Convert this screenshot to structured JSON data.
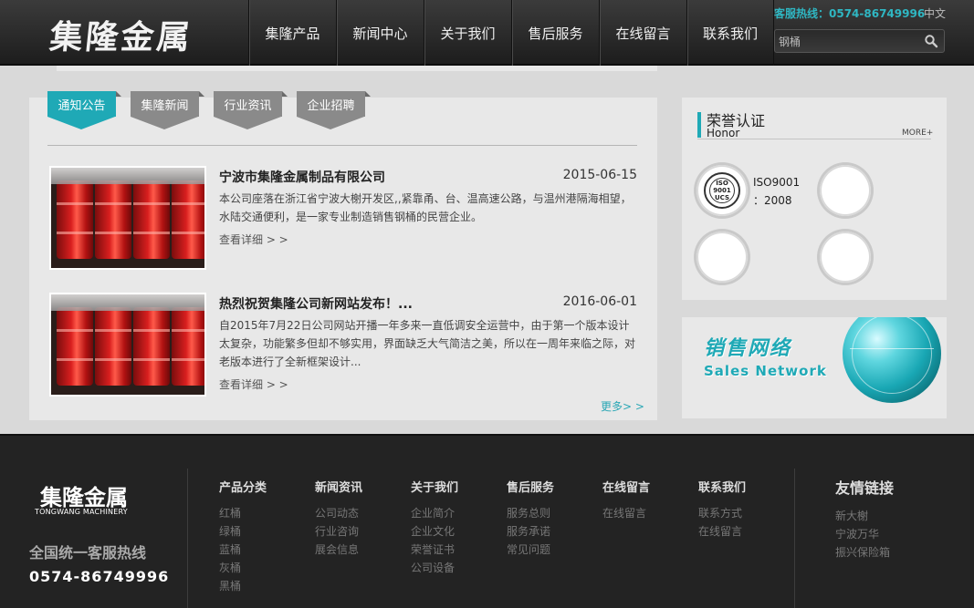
{
  "header": {
    "logo": "集隆金属",
    "nav": [
      "集隆产品",
      "新闻中心",
      "关于我们",
      "售后服务",
      "在线留言",
      "联系我们"
    ],
    "hotline": "客服热线：0574-86749996",
    "lang": "中文",
    "search_value": "钢桶"
  },
  "news": {
    "tabs": [
      "通知公告",
      "集隆新闻",
      "行业资讯",
      "企业招聘"
    ],
    "active_tab": 0,
    "items": [
      {
        "title": "宁波市集隆金属制品有限公司",
        "date": "2015-06-15",
        "desc": "本公司座落在浙江省宁波大榭开发区,,紧靠甬、台、温高速公路，与温州港隔海相望，水陆交通便利，是一家专业制造销售钢桶的民营企业。",
        "more": "查看详细 > >"
      },
      {
        "title": "热烈祝贺集隆公司新网站发布！...",
        "date": "2016-06-01",
        "desc": "自2015年7月22日公司网站开播一年多来一直低调安全运营中，由于第一个版本设计太复杂，功能繁多但却不够实用，界面缺乏大气简洁之美，所以在一周年来临之际，对老版本进行了全新框架设计...",
        "more": "查看详细 > >"
      }
    ],
    "more": "更多> >"
  },
  "honor": {
    "title": "荣誉认证",
    "subtitle": "Honor",
    "more": "MORE+",
    "cert_label_1": "ISO9001",
    "cert_label_2": "：2008",
    "iso_text_1": "ISO",
    "iso_text_2": "9001",
    "iso_text_3": "UCS"
  },
  "sales": {
    "cn": "销售网络",
    "en": "Sales Network"
  },
  "footer": {
    "logo": "集隆金属",
    "logo_en": "TONGWANG MACHINERY",
    "hotline_label": "全国统一客服热线",
    "hotline": "0574-86749996",
    "columns": [
      {
        "title": "产品分类",
        "items": [
          "红桶",
          "绿桶",
          "蓝桶",
          "灰桶",
          "黑桶"
        ]
      },
      {
        "title": "新闻资讯",
        "items": [
          "公司动态",
          "行业咨询",
          "展会信息"
        ]
      },
      {
        "title": "关于我们",
        "items": [
          "企业简介",
          "企业文化",
          "荣誉证书",
          "公司设备"
        ]
      },
      {
        "title": "售后服务",
        "items": [
          "服务总则",
          "服务承诺",
          "常见问题"
        ]
      },
      {
        "title": "在线留言",
        "items": [
          "在线留言"
        ]
      },
      {
        "title": "联系我们",
        "items": [
          "联系方式",
          "在线留言"
        ]
      }
    ],
    "links": {
      "title": "友情链接",
      "items": [
        "新大榭",
        "宁波万华",
        "振兴保险箱"
      ]
    }
  },
  "colors": {
    "accent": "#1fa9b6",
    "tab_inactive": "#8a8a8a",
    "header_bg": "#2b2b2b",
    "footer_bg": "#232323"
  }
}
